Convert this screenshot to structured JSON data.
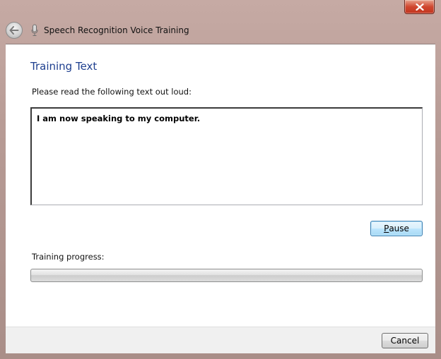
{
  "window": {
    "title": "Speech Recognition Voice Training",
    "close_icon": "close-icon",
    "back_icon": "back-arrow-icon",
    "app_icon": "microphone-icon"
  },
  "main": {
    "heading": "Training Text",
    "instruction": "Please read the following text out loud:",
    "read_text": "I am now speaking to my computer.",
    "pause_button": {
      "mnemonic": "P",
      "rest": "ause"
    },
    "progress_label": "Training progress:",
    "progress_value": 0
  },
  "footer": {
    "cancel_label": "Cancel"
  },
  "colors": {
    "heading": "#1e3f8f",
    "close_button": "#c2351f",
    "focus_button_border": "#3c7fb1"
  }
}
